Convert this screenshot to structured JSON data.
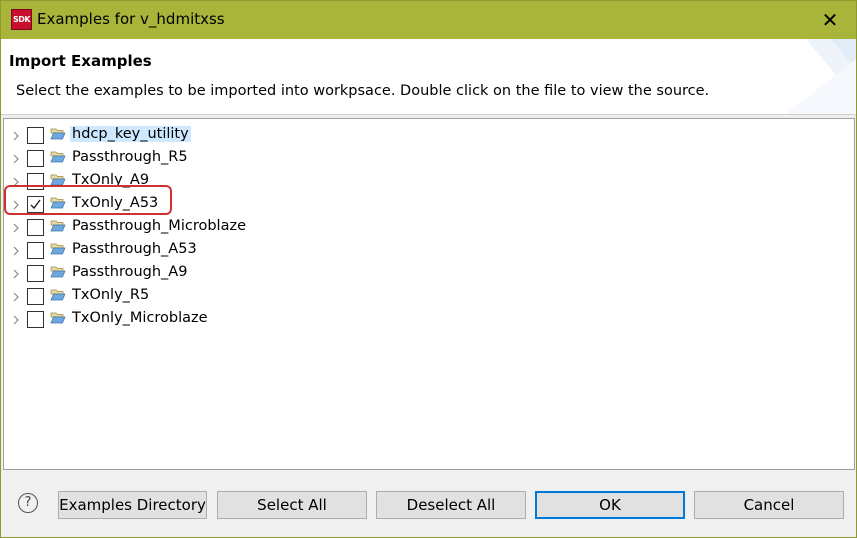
{
  "window": {
    "title": "Examples for v_hdmitxss",
    "app_icon_text": "SDK",
    "close_glyph": "✕"
  },
  "header": {
    "title": "Import Examples",
    "description": "Select the examples to be imported into workpsace. Double click on the file to view the source."
  },
  "tree": {
    "items": [
      {
        "label": "hdcp_key_utility",
        "checked": false,
        "selected": true
      },
      {
        "label": "Passthrough_R5",
        "checked": false,
        "selected": false
      },
      {
        "label": "TxOnly_A9",
        "checked": false,
        "selected": false
      },
      {
        "label": "TxOnly_A53",
        "checked": true,
        "selected": false
      },
      {
        "label": "Passthrough_Microblaze",
        "checked": false,
        "selected": false
      },
      {
        "label": "Passthrough_A53",
        "checked": false,
        "selected": false
      },
      {
        "label": "Passthrough_A9",
        "checked": false,
        "selected": false
      },
      {
        "label": "TxOnly_R5",
        "checked": false,
        "selected": false
      },
      {
        "label": "TxOnly_Microblaze",
        "checked": false,
        "selected": false
      }
    ]
  },
  "footer": {
    "help_glyph": "?",
    "examples_directory_label": "Examples Directory",
    "select_all_label": "Select All",
    "deselect_all_label": "Deselect All",
    "ok_label": "OK",
    "cancel_label": "Cancel"
  },
  "colors": {
    "titlebar": "#a8b53a",
    "highlight": "#d03030",
    "selection": "#cde8ff",
    "default_button_border": "#0078d7",
    "folder": "#6fa8dc"
  }
}
